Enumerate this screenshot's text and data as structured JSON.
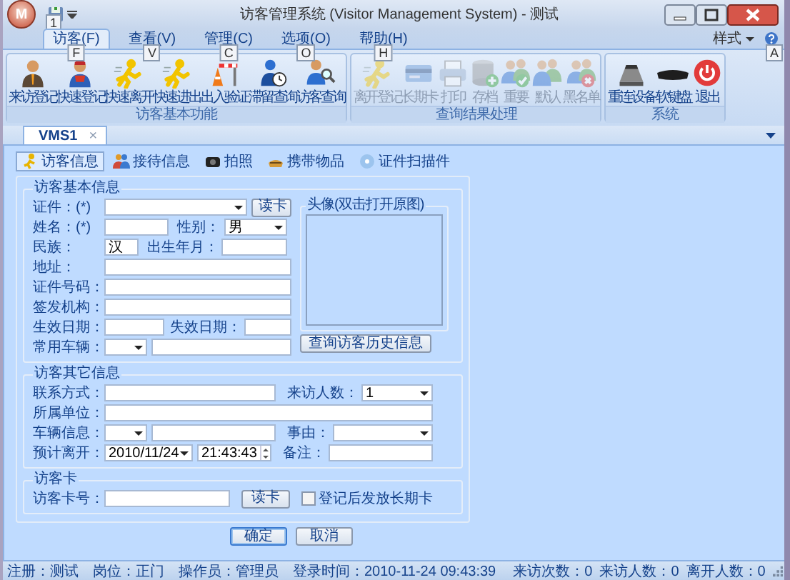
{
  "window": {
    "app_button": "M",
    "quick_access_keytip": "1",
    "title": "访客管理系统 (Visitor Management System) - 测试"
  },
  "ribbon": {
    "tabs": [
      {
        "label": "访客(F)",
        "keytip": "F",
        "selected": true
      },
      {
        "label": "查看(V)",
        "keytip": "V",
        "selected": false
      },
      {
        "label": "管理(C)",
        "keytip": "C",
        "selected": false
      },
      {
        "label": "选项(O)",
        "keytip": "O",
        "selected": false
      },
      {
        "label": "帮助(H)",
        "keytip": "H",
        "selected": false
      }
    ],
    "style_menu": "样式",
    "help_keytip": "A",
    "groups": [
      {
        "label": "访客基本功能",
        "buttons": [
          {
            "label": "来访登记",
            "kind": "person",
            "disabled": false
          },
          {
            "label": "快速登记",
            "kind": "person-red",
            "disabled": false
          },
          {
            "label": "快速离开",
            "kind": "runner",
            "disabled": false
          },
          {
            "label": "快速进出",
            "kind": "runner",
            "disabled": false
          },
          {
            "label": "出入验证",
            "kind": "barrier",
            "disabled": false
          },
          {
            "label": "滞留查询",
            "kind": "clock-person",
            "disabled": false
          },
          {
            "label": "访客查询",
            "kind": "search-person",
            "disabled": false
          }
        ]
      },
      {
        "label": "查询结果处理",
        "buttons": [
          {
            "label": "离开登记",
            "kind": "runner",
            "disabled": true
          },
          {
            "label": "长期卡",
            "kind": "card",
            "disabled": true
          },
          {
            "label": "打印",
            "kind": "printer",
            "disabled": true
          },
          {
            "label": "存档",
            "kind": "database",
            "disabled": true
          },
          {
            "label": "重要",
            "kind": "group-check",
            "disabled": true
          },
          {
            "label": "默认",
            "kind": "group",
            "disabled": true
          },
          {
            "label": "黑名单",
            "kind": "group-x",
            "disabled": true
          }
        ]
      },
      {
        "label": "系统",
        "buttons": [
          {
            "label": "重连设备",
            "kind": "device",
            "disabled": false
          },
          {
            "label": "软键盘",
            "kind": "keyboard",
            "disabled": false
          },
          {
            "label": "退出",
            "kind": "power",
            "disabled": false
          }
        ]
      }
    ]
  },
  "document_tabs": [
    {
      "label": "VMS1",
      "close": "×",
      "selected": true
    }
  ],
  "visitor_tabs": [
    {
      "label": "访客信息",
      "kind": "visitor",
      "selected": true
    },
    {
      "label": "接待信息",
      "kind": "reception",
      "selected": false
    },
    {
      "label": "拍照",
      "kind": "camera",
      "selected": false
    },
    {
      "label": "携带物品",
      "kind": "items",
      "selected": false
    },
    {
      "label": "证件扫描件",
      "kind": "scan",
      "selected": false
    }
  ],
  "basic_info": {
    "title": "访客基本信息",
    "id_type": {
      "label": "证件：(*)"
    },
    "read_card_button": "读卡",
    "name": {
      "label": "姓名：(*)"
    },
    "gender": {
      "label": "性别：",
      "value": "男"
    },
    "ethnicity": {
      "label": "民族：",
      "value": "汉"
    },
    "birth": {
      "label": "出生年月："
    },
    "address": {
      "label": "地址："
    },
    "id_number": {
      "label": "证件号码："
    },
    "issuer": {
      "label": "签发机构："
    },
    "valid_from": {
      "label": "生效日期："
    },
    "valid_to": {
      "label": "失效日期："
    },
    "vehicle": {
      "label": "常用车辆："
    },
    "photo_title": "头像(双击打开原图)",
    "history_button": "查询访客历史信息"
  },
  "other_info": {
    "title": "访客其它信息",
    "contact": {
      "label": "联系方式："
    },
    "visitors": {
      "label": "来访人数：",
      "value": "1"
    },
    "company": {
      "label": "所属单位："
    },
    "vehicle_info": {
      "label": "车辆信息："
    },
    "reason": {
      "label": "事由："
    },
    "leave_time": {
      "label": "预计离开：",
      "date": "2010/11/24",
      "time": "21:43:43"
    },
    "remark": {
      "label": "备注："
    }
  },
  "visitor_card": {
    "title": "访客卡",
    "card_no": {
      "label": "访客卡号："
    },
    "read_card_button": "读卡",
    "long_term": {
      "label": "登记后发放长期卡",
      "checked": false
    }
  },
  "actions": [
    {
      "label": "确定",
      "default": true
    },
    {
      "label": "取消",
      "default": false
    }
  ],
  "status_bar": {
    "left": [
      "注册：测试",
      "岗位：正门",
      "操作员：管理员",
      "登录时间：2010-11-24 09:43:39"
    ],
    "right": [
      "来访次数：0",
      "来访人数：0",
      "离开人数：0"
    ]
  }
}
